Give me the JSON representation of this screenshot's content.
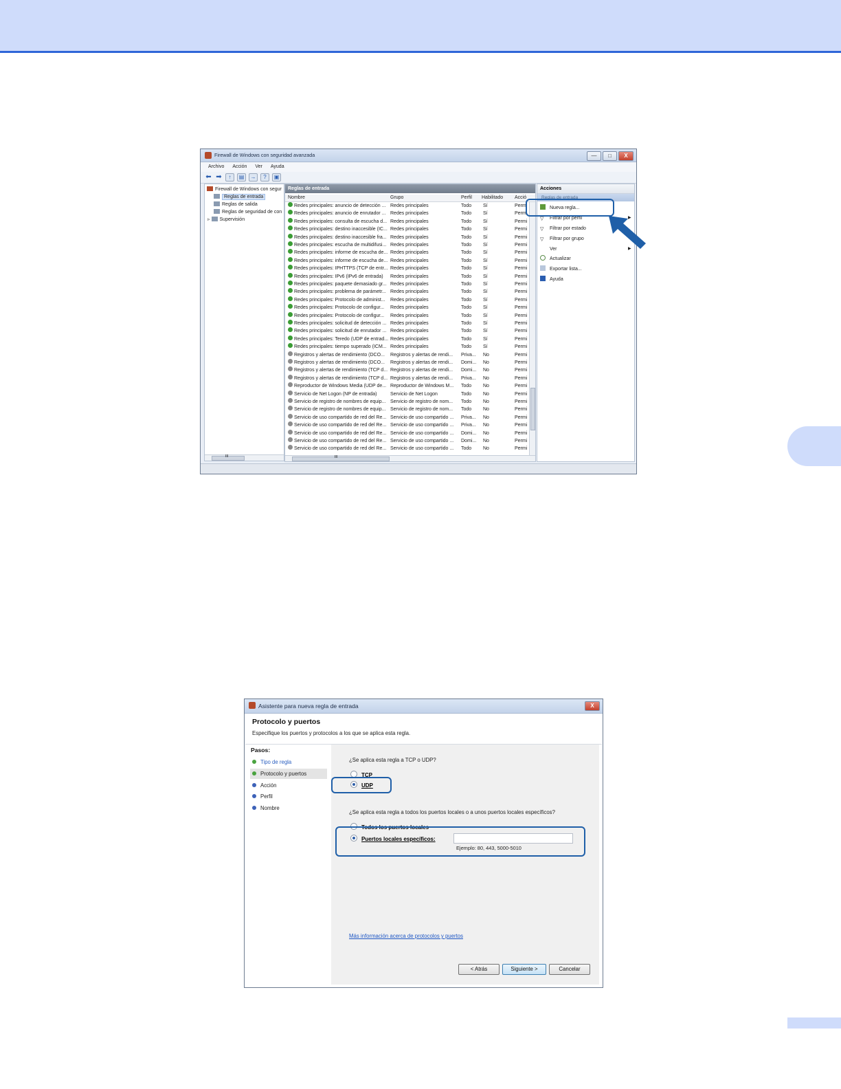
{
  "firewall_window": {
    "title": "Firewall de Windows con seguridad avanzada",
    "window_buttons": [
      "—",
      "□",
      "X"
    ],
    "menu": [
      "Archivo",
      "Acción",
      "Ver",
      "Ayuda"
    ],
    "tree": {
      "root": "Firewall de Windows con segur",
      "items": [
        "Reglas de entrada",
        "Reglas de salida",
        "Reglas de seguridad de con",
        "Supervisión"
      ],
      "scroll_marker": "III"
    },
    "center": {
      "header": "Reglas de entrada",
      "columns": [
        "Nombre",
        "Grupo",
        "Perfil",
        "Habilitado",
        "Acció"
      ],
      "scroll_marker": "III",
      "rows": [
        {
          "name": "Redes principales: anuncio de detección ...",
          "group": "Redes principales",
          "profile": "Todo",
          "enabled": "Sí",
          "action": "Permi",
          "on": true
        },
        {
          "name": "Redes principales: anuncio de enrutador ...",
          "group": "Redes principales",
          "profile": "Todo",
          "enabled": "Sí",
          "action": "Permi",
          "on": true
        },
        {
          "name": "Redes principales: consulta de escucha d...",
          "group": "Redes principales",
          "profile": "Todo",
          "enabled": "Sí",
          "action": "Permi",
          "on": true
        },
        {
          "name": "Redes principales: destino inaccesible (IC...",
          "group": "Redes principales",
          "profile": "Todo",
          "enabled": "Sí",
          "action": "Permi",
          "on": true
        },
        {
          "name": "Redes principales: destino inaccesible fra...",
          "group": "Redes principales",
          "profile": "Todo",
          "enabled": "Sí",
          "action": "Permi",
          "on": true
        },
        {
          "name": "Redes principales: escucha de multidifusi...",
          "group": "Redes principales",
          "profile": "Todo",
          "enabled": "Sí",
          "action": "Permi",
          "on": true
        },
        {
          "name": "Redes principales: informe de escucha de...",
          "group": "Redes principales",
          "profile": "Todo",
          "enabled": "Sí",
          "action": "Permi",
          "on": true
        },
        {
          "name": "Redes principales: informe de escucha de...",
          "group": "Redes principales",
          "profile": "Todo",
          "enabled": "Sí",
          "action": "Permi",
          "on": true
        },
        {
          "name": "Redes principales: IPHTTPS (TCP de entr...",
          "group": "Redes principales",
          "profile": "Todo",
          "enabled": "Sí",
          "action": "Permi",
          "on": true
        },
        {
          "name": "Redes principales: IPv6 (IPv6 de entrada)",
          "group": "Redes principales",
          "profile": "Todo",
          "enabled": "Sí",
          "action": "Permi",
          "on": true
        },
        {
          "name": "Redes principales: paquete demasiado gr...",
          "group": "Redes principales",
          "profile": "Todo",
          "enabled": "Sí",
          "action": "Permi",
          "on": true
        },
        {
          "name": "Redes principales: problema de parámetr...",
          "group": "Redes principales",
          "profile": "Todo",
          "enabled": "Sí",
          "action": "Permi",
          "on": true
        },
        {
          "name": "Redes principales: Protocolo de administ...",
          "group": "Redes principales",
          "profile": "Todo",
          "enabled": "Sí",
          "action": "Permi",
          "on": true
        },
        {
          "name": "Redes principales: Protocolo de configur...",
          "group": "Redes principales",
          "profile": "Todo",
          "enabled": "Sí",
          "action": "Permi",
          "on": true
        },
        {
          "name": "Redes principales: Protocolo de configur...",
          "group": "Redes principales",
          "profile": "Todo",
          "enabled": "Sí",
          "action": "Permi",
          "on": true
        },
        {
          "name": "Redes principales: solicitud de detección ...",
          "group": "Redes principales",
          "profile": "Todo",
          "enabled": "Sí",
          "action": "Permi",
          "on": true
        },
        {
          "name": "Redes principales: solicitud de enrutador ...",
          "group": "Redes principales",
          "profile": "Todo",
          "enabled": "Sí",
          "action": "Permi",
          "on": true
        },
        {
          "name": "Redes principales: Teredo (UDP de entrad...",
          "group": "Redes principales",
          "profile": "Todo",
          "enabled": "Sí",
          "action": "Permi",
          "on": true
        },
        {
          "name": "Redes principales: tiempo superado (ICM...",
          "group": "Redes principales",
          "profile": "Todo",
          "enabled": "Sí",
          "action": "Permi",
          "on": true
        },
        {
          "name": "Registros y alertas de rendimiento (DCO...",
          "group": "Registros y alertas de rendi...",
          "profile": "Priva...",
          "enabled": "No",
          "action": "Permi",
          "on": false
        },
        {
          "name": "Registros y alertas de rendimiento (DCO...",
          "group": "Registros y alertas de rendi...",
          "profile": "Domi...",
          "enabled": "No",
          "action": "Permi",
          "on": false
        },
        {
          "name": "Registros y alertas de rendimiento (TCP d...",
          "group": "Registros y alertas de rendi...",
          "profile": "Domi...",
          "enabled": "No",
          "action": "Permi",
          "on": false
        },
        {
          "name": "Registros y alertas de rendimiento (TCP d...",
          "group": "Registros y alertas de rendi...",
          "profile": "Priva...",
          "enabled": "No",
          "action": "Permi",
          "on": false
        },
        {
          "name": "Reproductor de Windows Media (UDP de...",
          "group": "Reproductor de Windows M...",
          "profile": "Todo",
          "enabled": "No",
          "action": "Permi",
          "on": false
        },
        {
          "name": "Servicio de Net Logon (NP de entrada)",
          "group": "Servicio de Net Logon",
          "profile": "Todo",
          "enabled": "No",
          "action": "Permi",
          "on": false
        },
        {
          "name": "Servicio de registro de nombres de equip...",
          "group": "Servicio de registro de nom...",
          "profile": "Todo",
          "enabled": "No",
          "action": "Permi",
          "on": false
        },
        {
          "name": "Servicio de registro de nombres de equip...",
          "group": "Servicio de registro de nom...",
          "profile": "Todo",
          "enabled": "No",
          "action": "Permi",
          "on": false
        },
        {
          "name": "Servicio de uso compartido de red del Re...",
          "group": "Servicio de uso compartido ...",
          "profile": "Priva...",
          "enabled": "No",
          "action": "Permi",
          "on": false
        },
        {
          "name": "Servicio de uso compartido de red del Re...",
          "group": "Servicio de uso compartido ...",
          "profile": "Priva...",
          "enabled": "No",
          "action": "Permi",
          "on": false
        },
        {
          "name": "Servicio de uso compartido de red del Re...",
          "group": "Servicio de uso compartido ...",
          "profile": "Domi...",
          "enabled": "No",
          "action": "Permi",
          "on": false
        },
        {
          "name": "Servicio de uso compartido de red del Re...",
          "group": "Servicio de uso compartido ...",
          "profile": "Domi...",
          "enabled": "No",
          "action": "Permi",
          "on": false
        },
        {
          "name": "Servicio de uso compartido de red del Re...",
          "group": "Servicio de uso compartido ...",
          "profile": "Todo",
          "enabled": "No",
          "action": "Permi",
          "on": false
        }
      ]
    },
    "actions": {
      "header": "Acciones",
      "subheader": "Reglas de entrada",
      "items": [
        "Nueva regla...",
        "Filtrar por perfil",
        "Filtrar por estado",
        "Filtrar por grupo",
        "Ver",
        "Actualizar",
        "Exportar lista...",
        "Ayuda"
      ]
    }
  },
  "wizard": {
    "title": "Asistente para nueva regla de entrada",
    "heading": "Protocolo y puertos",
    "description": "Especifique los puertos y protocolos a los que se aplica esta regla.",
    "steps_label": "Pasos:",
    "steps": [
      "Tipo de regla",
      "Protocolo y puertos",
      "Acción",
      "Perfil",
      "Nombre"
    ],
    "question_protocol": "¿Se aplica esta regla a TCP o UDP?",
    "option_tcp": "TCP",
    "option_udp": "UDP",
    "question_ports": "¿Se aplica esta regla a todos los puertos locales o a unos puertos locales específicos?",
    "option_all_ports": "Todos los puertos locales",
    "option_specific_ports": "Puertos locales específicos:",
    "port_value": "",
    "port_example": "Ejemplo: 80, 443, 5000-5010",
    "info_link": "Más información acerca de protocolos y puertos",
    "back_button": "< Atrás",
    "next_button": "Siguiente >",
    "cancel_button": "Cancelar",
    "close_button": "X"
  },
  "colors": {
    "header_band": "#cfdcfb",
    "header_line": "#2e66d8",
    "callout": "#1f5fa8",
    "rule_enabled": "#3b9c35",
    "rule_disabled": "#8c8c8c",
    "link": "#1d56c4"
  }
}
